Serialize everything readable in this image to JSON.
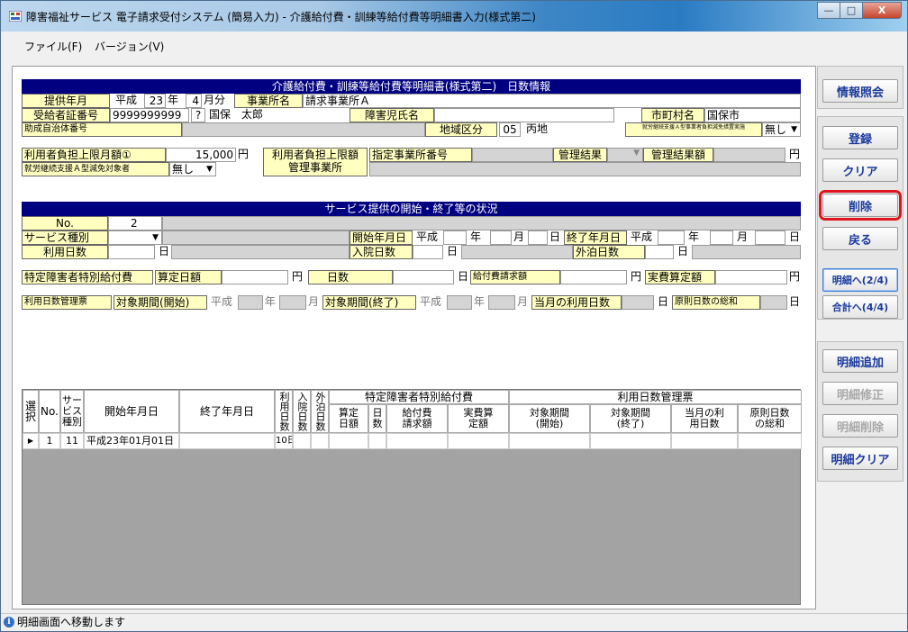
{
  "window": {
    "title": "障害福祉サービス 電子請求受付システム (簡易入力) - 介護給付費・訓練等給付費等明細書入力(様式第二)",
    "min_glyph": "—",
    "max_glyph": "□",
    "close_glyph": "X"
  },
  "menu": [
    {
      "label": "ファイル(F)"
    },
    {
      "label": "バージョン(V)"
    }
  ],
  "header": {
    "section_title": "介護給付費・訓練等給付費等明細書(様式第二)　日数情報",
    "provide_ym_label": "提供年月",
    "era": "平成",
    "year": "23",
    "year_unit": "年",
    "month": "4",
    "month_unit": "月分",
    "office_name_label": "事業所名",
    "office_name": "請求事業所Ａ",
    "recipient_no_label": "受給者証番号",
    "recipient_no": "9999999999",
    "question_btn": "?",
    "recipient_name": "国保　太郎",
    "child_name_label": "障害児氏名",
    "city_label": "市町村名",
    "city_name": "国保市",
    "subsidy_label": "助成自治体番号",
    "region_label": "地域区分",
    "region_code": "05",
    "region_name": "丙地",
    "exempt_label": "就労継続支援Ａ型事業者負担減免措置実施",
    "exempt_value": "無し",
    "limit_label": "利用者負担上限月額①",
    "limit_value": "15,000",
    "yen": "円",
    "limit_office_label_1": "利用者負担上限額",
    "limit_office_label_2": "管理事業所",
    "designated_no_label": "指定事業所番号",
    "mgmt_result_label": "管理結果",
    "mgmt_result_amount_label": "管理結果額",
    "a_type_label": "就労継続支援Ａ型減免対象者",
    "a_type_value": "無し"
  },
  "service": {
    "section_title": "サービス提供の開始・終了等の状況",
    "no_label": "No.",
    "no_value": "2",
    "type_label": "サービス種別",
    "start_label": "開始年月日",
    "end_label": "終了年月日",
    "era": "平成",
    "year_unit": "年",
    "month_unit": "月",
    "day_unit": "日",
    "use_days_label": "利用日数",
    "hosp_days_label": "入院日数",
    "overnight_days_label": "外泊日数",
    "special_label": "特定障害者特別給付費",
    "calc_daily_label": "算定日額",
    "days_label": "日数",
    "benefit_claim_label": "給付費請求額",
    "actual_calc_label": "実費算定額",
    "mgmt_form_label": "利用日数管理票",
    "period_start_label": "対象期間(開始)",
    "period_end_label": "対象期間(終了)",
    "month_use_label": "当月の利用日数",
    "principle_total_label": "原則日数の総和"
  },
  "grid": {
    "headers": {
      "select": "選択",
      "no": "No.",
      "service_type": "サービス種別",
      "start": "開始年月日",
      "end": "終了年月日",
      "use_days": "利用日数",
      "hosp_days": "入院日数",
      "overnight_days": "外泊日数",
      "special_group": "特定障害者特別給付費",
      "calc_daily": "算定日額",
      "days": "日数",
      "benefit_claim": "給付費請求額",
      "actual_calc": "実費算定額",
      "mgmt_group": "利用日数管理票",
      "period_start": "対象期間(開始)",
      "period_end": "対象期間(終了)",
      "month_use": "当月の利用日数",
      "principle_total": "原則日数の総和"
    },
    "rows": [
      {
        "marker": "▶",
        "no": "1",
        "type": "11",
        "start": "平成23年01月01日",
        "end": "",
        "use_days": "10日"
      }
    ]
  },
  "status": {
    "message": "明細画面へ移動します",
    "right_1": "",
    "right_2": ""
  },
  "side": {
    "info": "情報照会",
    "register": "登録",
    "clear": "クリア",
    "delete": "削除",
    "back": "戻る",
    "to_detail": "明細へ(2/4)",
    "to_total": "合計へ(4/4)",
    "add_detail": "明細追加",
    "edit_detail": "明細修正",
    "delete_detail": "明細削除",
    "clear_detail": "明細クリア"
  },
  "colors": {
    "section_bg": "#000080",
    "label_bg": "#ffffc0",
    "highlight": "#e0141c",
    "button_text": "#1a3a9c"
  }
}
